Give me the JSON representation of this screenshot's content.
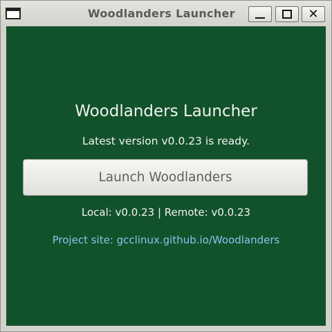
{
  "window": {
    "title": "Woodlanders Launcher",
    "controls": {
      "minimize": "minimize",
      "maximize": "maximize",
      "close": "✕"
    }
  },
  "main": {
    "heading": "Woodlanders Launcher",
    "status": "Latest version v0.0.23 is ready.",
    "launch_button_label": "Launch Woodlanders",
    "versions": "Local: v0.0.23 | Remote: v0.0.23",
    "project_link": "Project site: gcclinux.github.io/Woodlanders"
  },
  "colors": {
    "client_background": "#12522a",
    "link": "#86c5f0",
    "button_text": "#5f5f5f"
  },
  "icons": [
    "window-menu-icon",
    "minimize-icon",
    "maximize-icon",
    "close-icon"
  ]
}
